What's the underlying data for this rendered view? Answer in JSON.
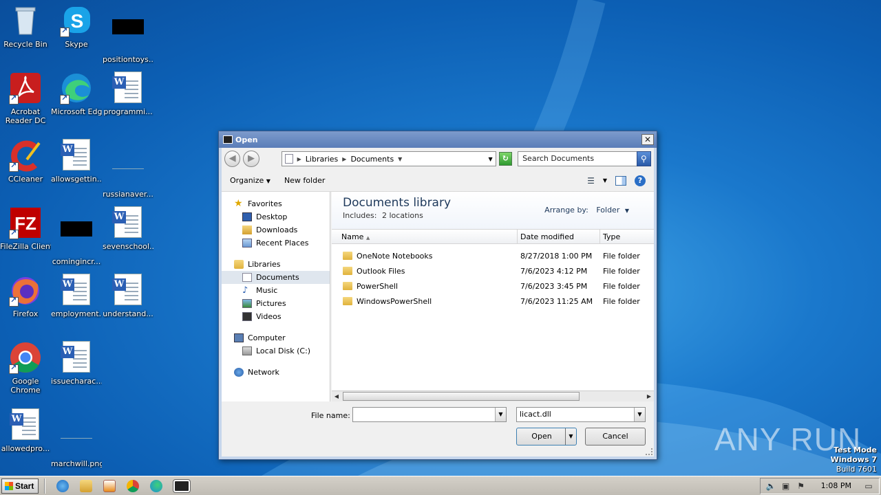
{
  "desktop": {
    "icons": [
      {
        "label": "Recycle Bin"
      },
      {
        "label": "Skype"
      },
      {
        "label": "positiontoys..."
      },
      {
        "label": "Acrobat Reader DC"
      },
      {
        "label": "Microsoft Edge"
      },
      {
        "label": "programmi..."
      },
      {
        "label": "CCleaner"
      },
      {
        "label": "allowsgettin..."
      },
      {
        "label": "russianaver..."
      },
      {
        "label": "FileZilla Client"
      },
      {
        "label": "comingincr..."
      },
      {
        "label": "sevenschool..."
      },
      {
        "label": "Firefox"
      },
      {
        "label": "employment..."
      },
      {
        "label": "understand..."
      },
      {
        "label": "Google Chrome"
      },
      {
        "label": "issuecharac..."
      },
      {
        "label": "allowedpro..."
      },
      {
        "label": "marchwill.png"
      }
    ]
  },
  "dialog": {
    "title": "Open",
    "close": "✕",
    "address": {
      "crumbs": [
        "Libraries",
        "Documents"
      ]
    },
    "search_placeholder": "Search Documents",
    "toolbar": {
      "organize": "Organize",
      "new_folder": "New folder"
    },
    "nav": {
      "favorites": "Favorites",
      "desktop": "Desktop",
      "downloads": "Downloads",
      "recent": "Recent Places",
      "libraries": "Libraries",
      "documents": "Documents",
      "music": "Music",
      "pictures": "Pictures",
      "videos": "Videos",
      "computer": "Computer",
      "local_disk": "Local Disk (C:)",
      "network": "Network"
    },
    "library": {
      "title": "Documents library",
      "includes_label": "Includes:",
      "includes_value": "2 locations",
      "arrange_label": "Arrange by:",
      "arrange_value": "Folder"
    },
    "columns": {
      "name": "Name",
      "date": "Date modified",
      "type": "Type"
    },
    "files": [
      {
        "name": "OneNote Notebooks",
        "date": "8/27/2018 1:00 PM",
        "type": "File folder"
      },
      {
        "name": "Outlook Files",
        "date": "7/6/2023 4:12 PM",
        "type": "File folder"
      },
      {
        "name": "PowerShell",
        "date": "7/6/2023 3:45 PM",
        "type": "File folder"
      },
      {
        "name": "WindowsPowerShell",
        "date": "7/6/2023 11:25 AM",
        "type": "File folder"
      }
    ],
    "file_name_label": "File name:",
    "file_name_value": "",
    "filter_value": "licact.dll",
    "open_button": "Open",
    "cancel_button": "Cancel"
  },
  "watermark": {
    "text": "ANY RUN"
  },
  "test_mode": {
    "line1": "Test Mode",
    "line2": "Windows 7",
    "line3": "Build 7601"
  },
  "taskbar": {
    "start": "Start",
    "clock": "1:08 PM"
  }
}
